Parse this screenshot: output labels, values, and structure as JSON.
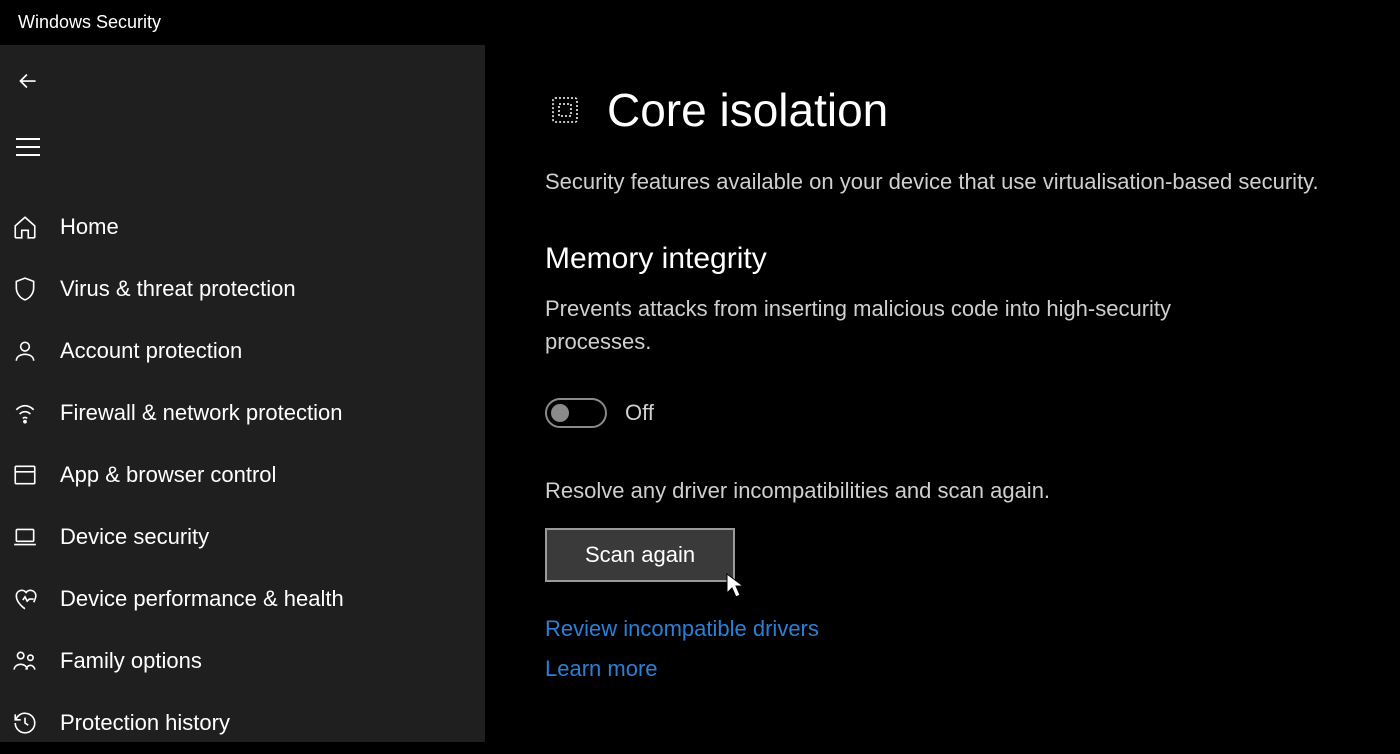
{
  "window": {
    "title": "Windows Security"
  },
  "sidebar": {
    "items": [
      {
        "label": "Home",
        "icon": "home"
      },
      {
        "label": "Virus & threat protection",
        "icon": "shield"
      },
      {
        "label": "Account protection",
        "icon": "account"
      },
      {
        "label": "Firewall & network protection",
        "icon": "wifi"
      },
      {
        "label": "App & browser control",
        "icon": "browser"
      },
      {
        "label": "Device security",
        "icon": "laptop"
      },
      {
        "label": "Device performance & health",
        "icon": "heart"
      },
      {
        "label": "Family options",
        "icon": "family"
      },
      {
        "label": "Protection history",
        "icon": "history"
      }
    ]
  },
  "main": {
    "title": "Core isolation",
    "description": "Security features available on your device that use virtualisation-based security.",
    "section": {
      "title": "Memory integrity",
      "description": "Prevents attacks from inserting malicious code into high-security processes."
    },
    "toggle": {
      "state": "Off"
    },
    "resolve_text": "Resolve any driver incompatibilities and scan again.",
    "scan_button": "Scan again",
    "links": {
      "review": "Review incompatible drivers",
      "learn": "Learn more"
    }
  }
}
